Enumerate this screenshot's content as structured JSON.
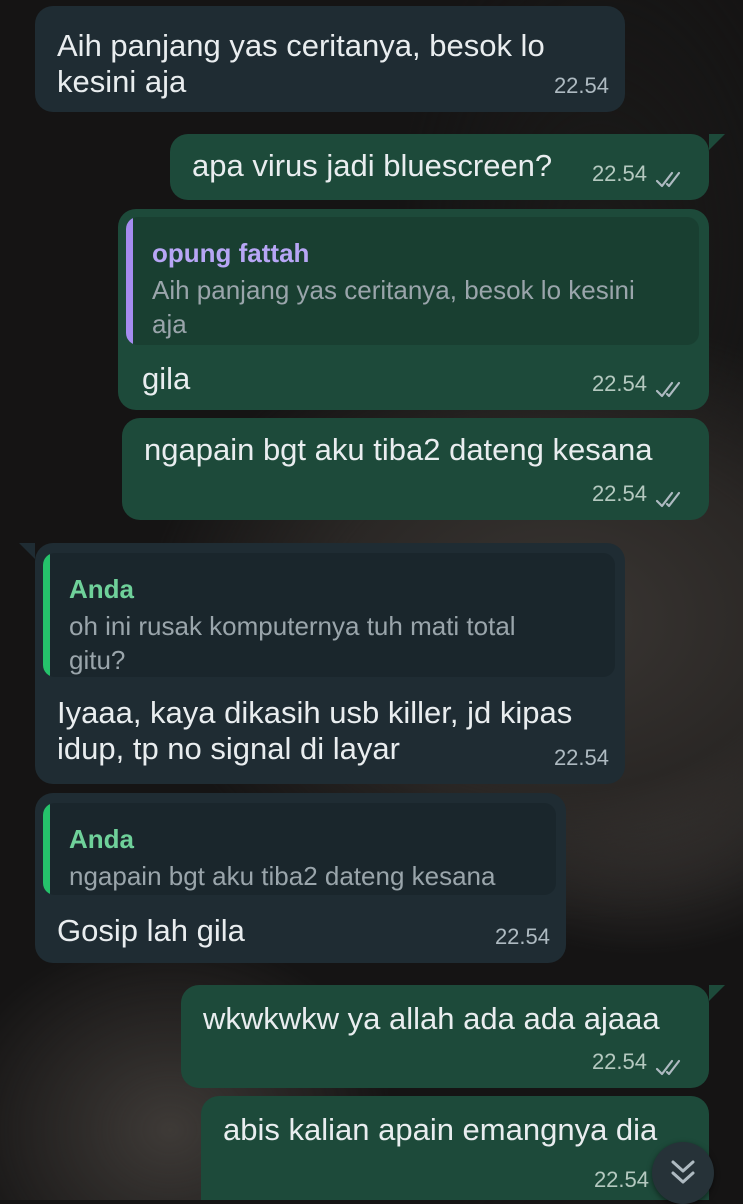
{
  "messages": [
    {
      "text": "Aih panjang yas ceritanya, besok lo\nkesini aja",
      "time": "22.54"
    },
    {
      "text": "apa virus jadi bluescreen?",
      "time": "22.54"
    },
    {
      "reply_name": "opung fattah",
      "reply_text": "Aih panjang yas ceritanya, besok lo kesini\naja",
      "text": "gila",
      "time": "22.54"
    },
    {
      "text": "ngapain bgt aku tiba2 dateng kesana",
      "time": "22.54"
    },
    {
      "reply_name": "Anda",
      "reply_text": "oh ini rusak komputernya tuh mati total\ngitu?",
      "text": "Iyaaa, kaya dikasih usb killer, jd kipas\nidup, tp no signal di layar",
      "time": "22.54"
    },
    {
      "reply_name": "Anda",
      "reply_text": "ngapain bgt aku tiba2 dateng kesana",
      "text": "Gosip lah gila",
      "time": "22.54"
    },
    {
      "text": "wkwkwkw ya allah ada ada ajaaa",
      "time": "22.54"
    },
    {
      "text": "abis kalian apain emangnya dia",
      "time": "22.54"
    }
  ],
  "colors": {
    "incoming_bubble": "#1f2c33",
    "outgoing_bubble": "#1d4a3a",
    "reply_name_purple": "#b7a6f5",
    "reply_bar_purple": "#a58cf0",
    "reply_name_green": "#6fd19a",
    "reply_bar_green": "#25c26b",
    "ticks": "#aebac1"
  },
  "icons": {
    "read_receipt": "double-check-icon",
    "scroll_down": "double-chevron-down-icon"
  }
}
